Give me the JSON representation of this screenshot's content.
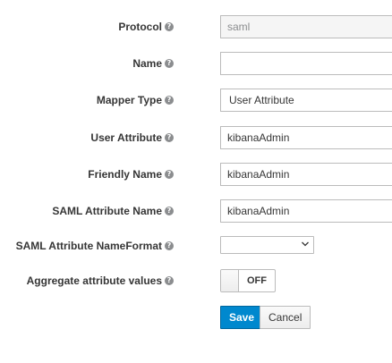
{
  "form": {
    "protocol": {
      "label": "Protocol",
      "value": "saml"
    },
    "name": {
      "label": "Name",
      "value": ""
    },
    "mapper_type": {
      "label": "Mapper Type",
      "value": "User Attribute"
    },
    "user_attribute": {
      "label": "User Attribute",
      "value": "kibanaAdmin"
    },
    "friendly_name": {
      "label": "Friendly Name",
      "value": "kibanaAdmin"
    },
    "saml_attribute_name": {
      "label": "SAML Attribute Name",
      "value": "kibanaAdmin"
    },
    "saml_attribute_nameformat": {
      "label": "SAML Attribute NameFormat",
      "value": ""
    },
    "aggregate": {
      "label": "Aggregate attribute values",
      "state": "OFF"
    }
  },
  "help_glyph": "?",
  "actions": {
    "save_label": "Save",
    "cancel_label": "Cancel"
  },
  "colors": {
    "primary": "#0088ce",
    "border": "#bbbbbb",
    "label": "#363636"
  }
}
